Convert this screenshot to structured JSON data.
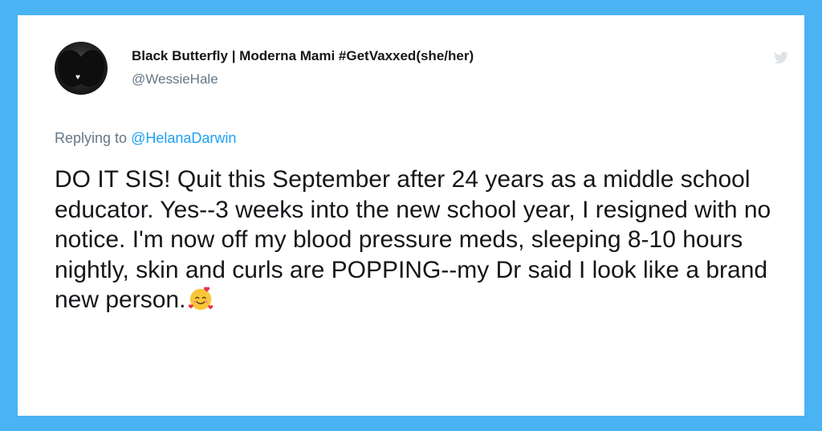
{
  "tweet": {
    "display_name": "Black Butterfly | Moderna Mami #GetVaxxed(she/her)",
    "handle": "@WessieHale",
    "replying_prefix": "Replying to ",
    "replying_to": "@HelanaDarwin",
    "text": "DO IT SIS! Quit this September after 24 years as a middle school educator. Yes--3 weeks into the new school year, I resigned with no notice. I'm now off my blood pressure meds, sleeping 8-10 hours nightly, skin and curls are POPPING--my Dr said I look like a brand new person.",
    "emoji": "smiling-face-with-hearts"
  },
  "icons": {
    "platform": "twitter-bird-icon",
    "avatar": "butterfly-avatar"
  },
  "colors": {
    "frame": "#4ab3f4",
    "card": "#ffffff",
    "text": "#14171a",
    "secondary": "#657786",
    "link": "#1da1f2"
  }
}
